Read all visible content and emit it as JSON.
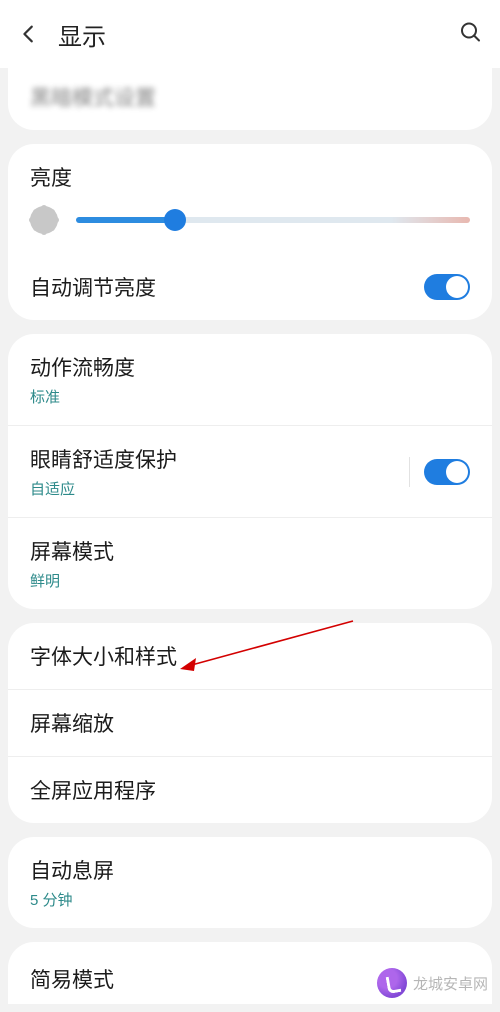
{
  "header": {
    "title": "显示"
  },
  "truncated_top_row": "黑暗模式设置",
  "brightness": {
    "section_title": "亮度",
    "auto_label": "自动调节亮度",
    "auto_on": true,
    "value_percent": 25
  },
  "group2": {
    "motion": {
      "title": "动作流畅度",
      "sub": "标准"
    },
    "eye": {
      "title": "眼睛舒适度保护",
      "sub": "自适应",
      "on": true
    },
    "mode": {
      "title": "屏幕模式",
      "sub": "鲜明"
    }
  },
  "group3": {
    "font": {
      "title": "字体大小和样式"
    },
    "zoom": {
      "title": "屏幕缩放"
    },
    "full": {
      "title": "全屏应用程序"
    }
  },
  "group4": {
    "timeout": {
      "title": "自动息屏",
      "sub": "5 分钟"
    }
  },
  "group5": {
    "easy": {
      "title": "简易模式"
    }
  },
  "watermark": "龙城安卓网"
}
